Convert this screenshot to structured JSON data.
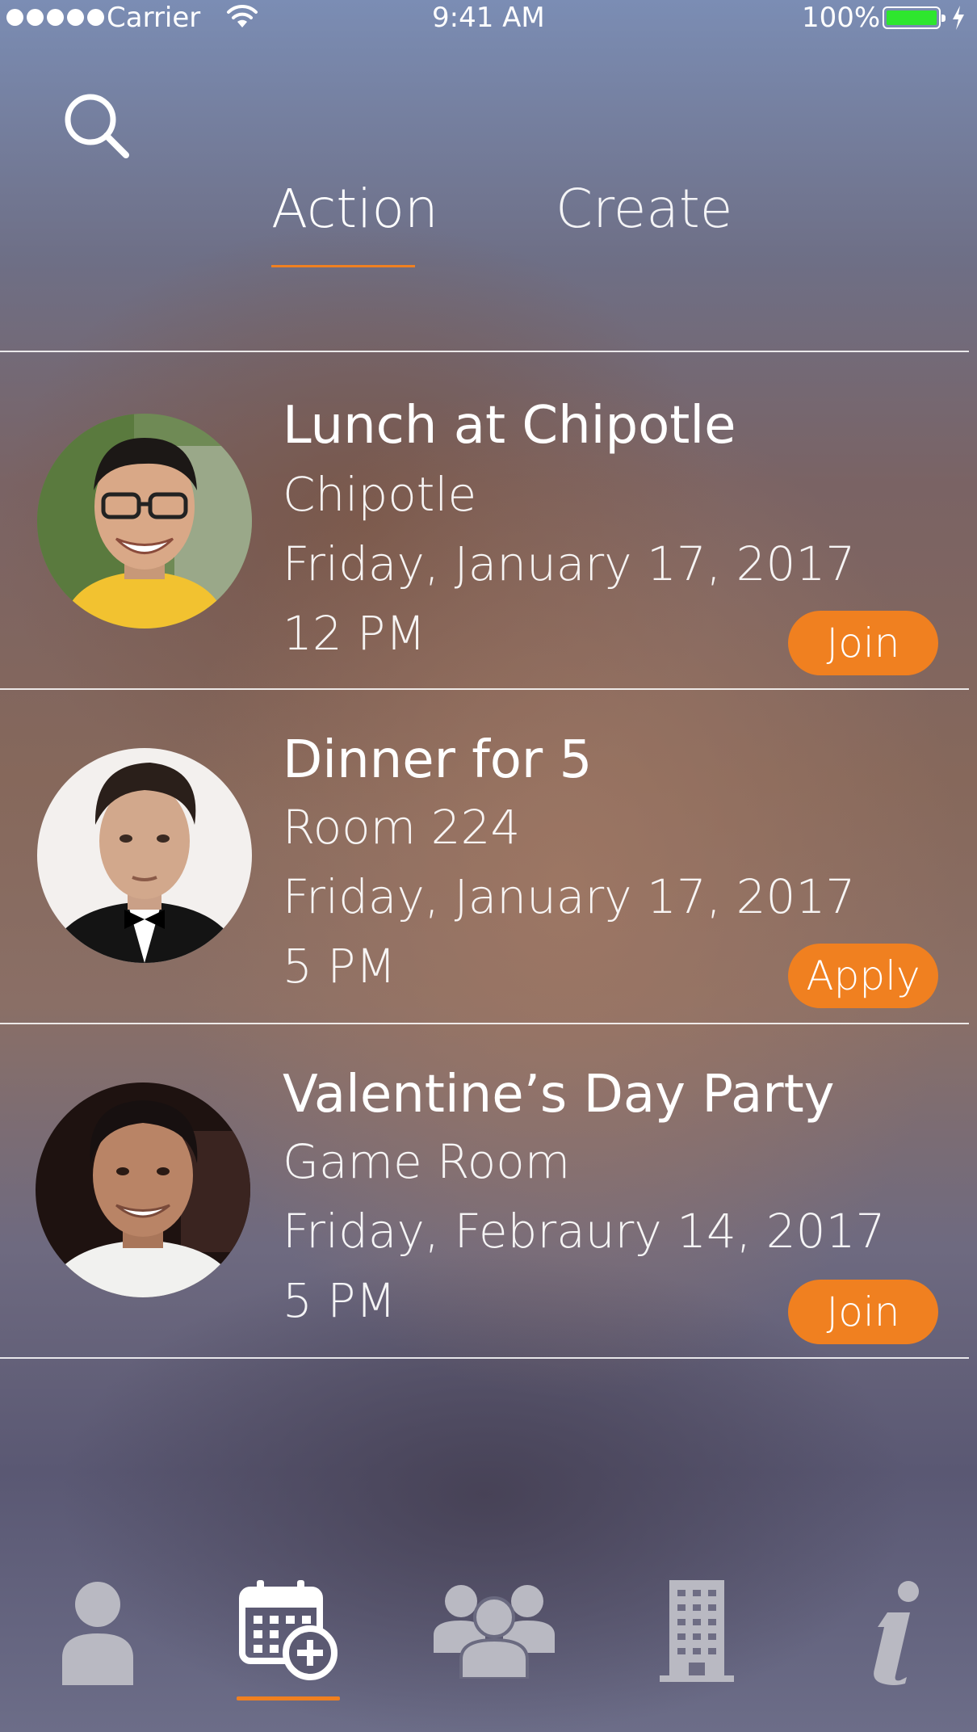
{
  "status_bar": {
    "carrier": "Carrier",
    "time": "9:41 AM",
    "battery": "100%"
  },
  "header": {
    "search_icon": "search-icon",
    "tabs": [
      {
        "label": "Action",
        "active": true
      },
      {
        "label": "Create",
        "active": false
      }
    ]
  },
  "events": [
    {
      "title": "Lunch at Chipotle",
      "location": "Chipotle",
      "date": "Friday, January 17, 2017",
      "time": "12 PM",
      "action": "Join"
    },
    {
      "title": "Dinner for 5",
      "location": "Room 224",
      "date": "Friday, January 17, 2017",
      "time": "5 PM",
      "action": "Apply"
    },
    {
      "title": "Valentine’s Day Party",
      "location": "Game Room",
      "date": "Friday, Febraury 14, 2017",
      "time": "5 PM",
      "action": "Join"
    }
  ],
  "tab_bar": {
    "items": [
      {
        "icon": "person-icon",
        "active": false
      },
      {
        "icon": "calendar-add-icon",
        "active": true
      },
      {
        "icon": "group-icon",
        "active": false
      },
      {
        "icon": "building-icon",
        "active": false
      },
      {
        "icon": "info-icon",
        "active": false
      }
    ]
  },
  "colors": {
    "accent": "#f08020",
    "battery": "#2ee62e",
    "inactive_icon": "#b9b9c2"
  }
}
